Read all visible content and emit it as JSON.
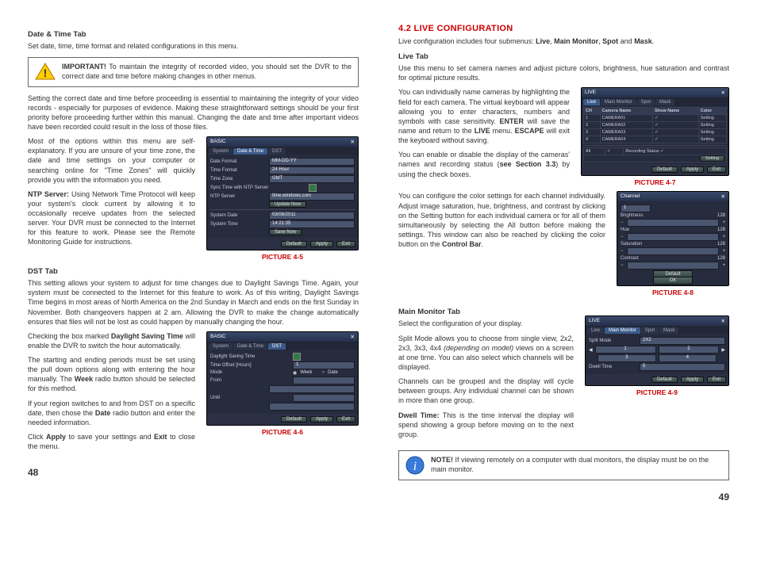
{
  "left": {
    "h_date_time_tab": "Date & Time Tab",
    "p_intro": "Set date, time, time format and related configurations in this menu.",
    "important_label": "IMPORTANT!",
    "important_text": " To maintain the integrity of recorded video, you should set the DVR to the correct date and time before making changes in other menus.",
    "p_setting_date": "Setting the correct date and time before proceeding is essential to maintaining the integrity of your video records - especially for purposes of evidence. Making these straightforward settings should be your first priority before proceeding further within this manual. Changing the date and time after important videos have been recorded could result in the loss of those files.",
    "p_most_options": "Most of the options within this menu are self-explanatory. If you are unsure of your time zone, the date and time settings on your computer or searching online for \"Time Zones\" will quickly provide you with the information you need.",
    "ntp_label": "NTP Server:",
    "ntp_text": " Using Network Time Protocol will keep your system's clock current by allowing it to occasionally receive updates from the selected server. Your DVR must be connected to the Internet for this feature to work. Please see the Remote Monitoring Guide for instructions.",
    "h_dst_tab": "DST Tab",
    "p_dst1": "This setting allows your system to adjust for time changes due to Daylight Savings Time. Again, your system must be connected to the Internet for this feature to work. As of this writing, Daylight Savings Time begins in most areas of North America on the 2nd Sunday in March and ends on the first Sunday in November. Both changeovers happen at 2 am. Allowing the DVR to make the change automatically ensures that files will not be lost as could happen by manually changing the hour.",
    "p_dst2a": "Checking the box marked ",
    "p_dst2b": "Daylight Saving Time",
    "p_dst2c": " will enable the DVR to switch the hour automatically.",
    "p_dst3a": "The starting and ending periods must be set using the pull down options along with entering the hour manually. The ",
    "p_dst3b": "Week",
    "p_dst3c": " radio button should be selected for this method.",
    "p_dst4a": "If your region switches to and from DST on a specific date, then chose the ",
    "p_dst4b": "Date",
    "p_dst4c": " radio button and enter the needed information.",
    "p_dst5a": "Click ",
    "p_dst5b": "Apply",
    "p_dst5c": " to save your settings and ",
    "p_dst5d": "Exit",
    "p_dst5e": " to close the menu.",
    "page_num": "48",
    "pic45": {
      "caption": "PICTURE 4-5",
      "title": "BASIC",
      "tabs": [
        "System",
        "Date & Time",
        "DST"
      ],
      "rows": {
        "r1l": "Date Format",
        "r1v": "MM-DD-YY",
        "r2l": "Time Format",
        "r2v": "24 Hour",
        "r3l": "Time Zone",
        "r3v": "GMT",
        "r4l": "Sync Time with NTP Server",
        "r5l": "NTP Server",
        "r5v": "time.windows.com",
        "r5b": "Update Now",
        "r6l": "System Date",
        "r6v": "03/08/2011",
        "r7l": "System Time",
        "r7v": "14:21:35",
        "r7b": "Save Now"
      },
      "btns": [
        "Default",
        "Apply",
        "Exit"
      ]
    },
    "pic46": {
      "caption": "PICTURE 4-6",
      "title": "BASIC",
      "tabs": [
        "System",
        "Date & Time",
        "DST"
      ],
      "rows": {
        "r1l": "Daylight Saving Time",
        "r2l": "Time Offset [Hours]",
        "r2v": "1",
        "r3l": "Mode",
        "r3a": "Week",
        "r3b": "Date",
        "r4l": "From",
        "r5l": "Until"
      },
      "btns": [
        "Default",
        "Apply",
        "Exit"
      ]
    }
  },
  "right": {
    "section": "4.2 LIVE CONFIGURATION",
    "intro_a": "Live configuration includes four submenus: ",
    "intro_b": "Live",
    "intro_c": ", ",
    "intro_d": "Main Monitor",
    "intro_e": ", ",
    "intro_f": "Spot",
    "intro_g": " and ",
    "intro_h": "Mask",
    "intro_i": ".",
    "h_live_tab": "Live Tab",
    "p_live1": "Use this menu to set camera names and adjust picture colors, brightness, hue saturation and contrast for optimal picture results.",
    "p_live2a": "You can individually name cameras by highlighting the field for each camera. The virtual keyboard will appear allowing you to enter characters, numbers and symbols with case sensitivity. ",
    "p_live2b": "ENTER",
    "p_live2c": " will save the name and return to the ",
    "p_live2d": "LIVE",
    "p_live2e": " menu. ",
    "p_live2f": "ESCAPE",
    "p_live2g": " will exit the keyboard without saving.",
    "p_live3a": "You can enable or disable the display of the cameras' names and recording status (",
    "p_live3b": "see Section 3.3",
    "p_live3c": ") by using the check boxes.",
    "p_color1": "You can configure the color settings for each channel individually. Adjust image saturation, hue, brightness, and contrast by clicking on the Setting button for each individual camera or for all of them simultaneously by selecting the All button before making the settings. This window can also be reached by clicking the color button on the ",
    "p_color2": "Control Bar",
    "p_color3": ".",
    "h_main_monitor": "Main Monitor Tab",
    "p_mm1": "Select the configuration of your display.",
    "p_mm2a": "Split Mode allows you to choose from single view, 2x2, 2x3, 3x3, 4x4 ",
    "p_mm2b": "(depending on model)",
    "p_mm2c": " views on a screen at one time. You can also select which channels will be displayed.",
    "p_mm3": "Channels can be grouped and the display will cycle between groups. Any individual channel can be shown in more than one group.",
    "p_mm4a": "Dwell Time:",
    "p_mm4b": " This is the time interval the display will spend showing a group before moving on to the next group.",
    "note_label": "NOTE!",
    "note_text": " If viewing remotely on a computer with dual monitors, the display must be on the main monitor.",
    "page_num": "49",
    "pic47": {
      "caption": "PICTURE 4-7",
      "title": "LIVE",
      "tabs": [
        "Live",
        "Main Monitor",
        "Spot",
        "Mask"
      ],
      "cols": [
        "CH",
        "Camera Name",
        "Show Name",
        "Color"
      ],
      "rows": [
        [
          "1",
          "CAMERA01",
          "✓",
          "Setting"
        ],
        [
          "2",
          "CAMERA02",
          "✓",
          "Setting"
        ],
        [
          "3",
          "CAMERA03",
          "✓",
          "Setting"
        ],
        [
          "4",
          "CAMERA04",
          "✓",
          "Setting"
        ]
      ],
      "allrow": [
        "All",
        "",
        "✓",
        "Recording Status ✓"
      ],
      "setting_btn": "Setting",
      "btns": [
        "Default",
        "Apply",
        "Exit"
      ]
    },
    "pic48": {
      "caption": "PICTURE 4-8",
      "title": "Channel",
      "ch_val": "1",
      "sliders": [
        [
          "Brightness",
          "128"
        ],
        [
          "Hue",
          "128"
        ],
        [
          "Saturation",
          "128"
        ],
        [
          "Contrast",
          "128"
        ]
      ],
      "btns": [
        "Default",
        "OK"
      ]
    },
    "pic49": {
      "caption": "PICTURE 4-9",
      "title": "LIVE",
      "tabs": [
        "Live",
        "Main Monitor",
        "Spot",
        "Mask"
      ],
      "split_label": "Split Mode",
      "split_val": "2X2",
      "chs": [
        "1",
        "2",
        "3",
        "4"
      ],
      "dwell_label": "Dwell Time",
      "dwell_val": "5",
      "btns": [
        "Default",
        "Apply",
        "Exit"
      ]
    }
  }
}
